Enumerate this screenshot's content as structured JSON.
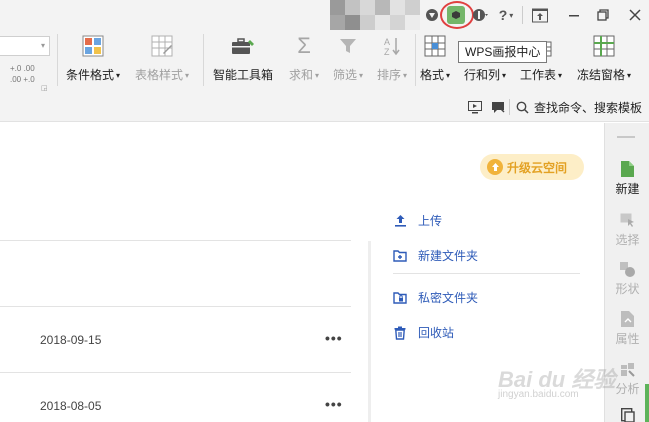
{
  "titlebar": {
    "wps_center_tooltip": "WPS画报中心",
    "help_label": "?"
  },
  "ribbon": {
    "decimal_increase": "+.0  .00",
    "decimal_decrease": ".00  +.0",
    "items": [
      {
        "label": "条件格式",
        "caret": "▾"
      },
      {
        "label": "表格样式",
        "caret": "▾"
      },
      {
        "label": "智能工具箱",
        "caret": ""
      },
      {
        "label": "求和",
        "caret": "▾"
      },
      {
        "label": "筛选",
        "caret": "▾"
      },
      {
        "label": "排序",
        "caret": "▾"
      },
      {
        "label": "格式",
        "caret": "▾"
      },
      {
        "label": "行和列",
        "caret": "▾"
      },
      {
        "label": "工作表",
        "caret": "▾"
      },
      {
        "label": "冻结窗格",
        "caret": "▾"
      }
    ]
  },
  "row2": {
    "search_command": "查找命令、搜索模板"
  },
  "main": {
    "upgrade_label": "升级云空间",
    "files": [
      {
        "date": "2018-09-15",
        "more": "•••"
      },
      {
        "date": "2018-08-05",
        "more": "•••"
      }
    ],
    "side_links": [
      {
        "label": "上传"
      },
      {
        "label": "新建文件夹"
      },
      {
        "label": "私密文件夹"
      },
      {
        "label": "回收站"
      }
    ]
  },
  "right_sidebar": {
    "items": [
      {
        "label": "新建",
        "active": true
      },
      {
        "label": "选择",
        "active": false
      },
      {
        "label": "形状",
        "active": false
      },
      {
        "label": "属性",
        "active": false
      },
      {
        "label": "分析",
        "active": false
      }
    ]
  },
  "watermark": {
    "text": "Bai du 经验",
    "sub": "jingyan.baidu.com"
  },
  "colors": {
    "accent_blue": "#2e5bb8",
    "wps_green": "#74b66a",
    "upgrade_gold": "#e3a123",
    "highlight_red": "#e04040"
  }
}
